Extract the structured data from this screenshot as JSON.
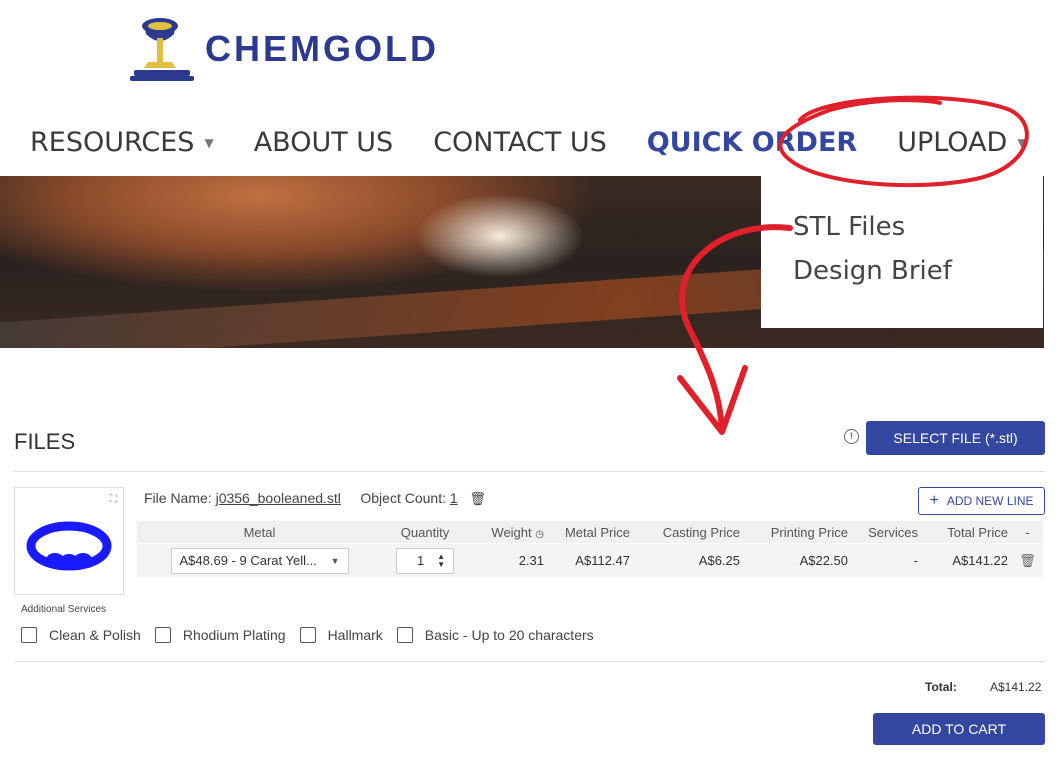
{
  "brand": {
    "name": "CHEMGOLD",
    "logo_icon": "crucible-pour-icon",
    "brand_color": "#2b3a8f"
  },
  "nav": {
    "items": [
      {
        "label": "RESOURCES",
        "has_caret": true
      },
      {
        "label": "ABOUT US",
        "has_caret": false
      },
      {
        "label": "CONTACT US",
        "has_caret": false
      },
      {
        "label": "QUICK ORDER",
        "has_caret": false,
        "active": true
      },
      {
        "label": "UPLOAD",
        "has_caret": true
      }
    ]
  },
  "upload_menu": {
    "items": [
      "STL Files",
      "Design Brief"
    ]
  },
  "files": {
    "title": "FILES",
    "select_button": "SELECT FILE (*.stl)",
    "file_name_label": "File Name:",
    "file_name": "j0356_booleaned.stl",
    "object_count_label": "Object Count:",
    "object_count": "1",
    "add_line_button": "ADD NEW LINE",
    "table": {
      "headers": [
        "Metal",
        "Quantity",
        "Weight",
        "Metal Price",
        "Casting Price",
        "Printing Price",
        "Services",
        "Total Price",
        "-"
      ],
      "row": {
        "metal": "A$48.69 - 9 Carat Yell...",
        "quantity": "1",
        "weight": "2.31",
        "metal_price": "A$112.47",
        "casting_price": "A$6.25",
        "printing_price": "A$22.50",
        "services": "-",
        "total_price": "A$141.22"
      }
    },
    "additional_services_label": "Additional Services",
    "services": [
      "Clean & Polish",
      "Rhodium Plating",
      "Hallmark",
      "Basic - Up to 20 characters"
    ],
    "total_label": "Total:",
    "total_value": "A$141.22",
    "add_to_cart": "ADD TO CART"
  },
  "colors": {
    "accent": "#3346a0",
    "annotation": "#e0202a",
    "model": "#1a1aff"
  }
}
